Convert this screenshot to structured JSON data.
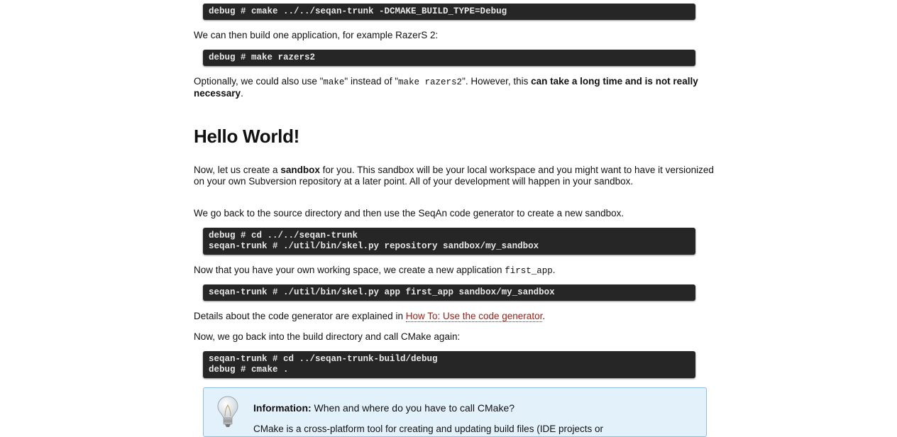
{
  "code1": [
    "debug # cmake ../../seqan-trunk -DCMAKE_BUILD_TYPE=Debug"
  ],
  "p1": "We can then build one application, for example RazerS 2:",
  "code2": [
    "debug # make razers2"
  ],
  "p2": {
    "a": "Optionally, we could also use \"",
    "code_a": "make",
    "b": "\" instead of \"",
    "code_b": "make razers2",
    "c": "\". However, this ",
    "bold": "can take a long time and is not really necessary",
    "d": "."
  },
  "heading": "Hello World!",
  "p3": {
    "a": "Now, let us create a ",
    "bold": "sandbox",
    "b": " for you. This sandbox will be your local workspace and you might want to have it versionized on your own Subversion repository at a later point. All of your development will happen in your sandbox."
  },
  "p4": "We go back to the source directory and then use the SeqAn code generator to create a new sandbox.",
  "code3": [
    "debug # cd ../../seqan-trunk",
    "seqan-trunk # ./util/bin/skel.py repository sandbox/my_sandbox"
  ],
  "p5": {
    "a": "Now that you have your own working space, we create a new application ",
    "code": "first_app",
    "b": "."
  },
  "code4": [
    "seqan-trunk # ./util/bin/skel.py app first_app sandbox/my_sandbox"
  ],
  "p6": {
    "a": "Details about the code generator are explained in ",
    "link": "How To: Use the code generator",
    "b": "."
  },
  "p7": "Now, we go back into the build directory and call CMake again:",
  "code5": [
    "seqan-trunk # cd ../seqan-trunk-build/debug",
    "debug # cmake ."
  ],
  "info": {
    "label": "Information:",
    "question": " When and where do you have to call CMake?",
    "body": "CMake is a cross-platform tool for creating and updating build files (IDE projects or"
  }
}
